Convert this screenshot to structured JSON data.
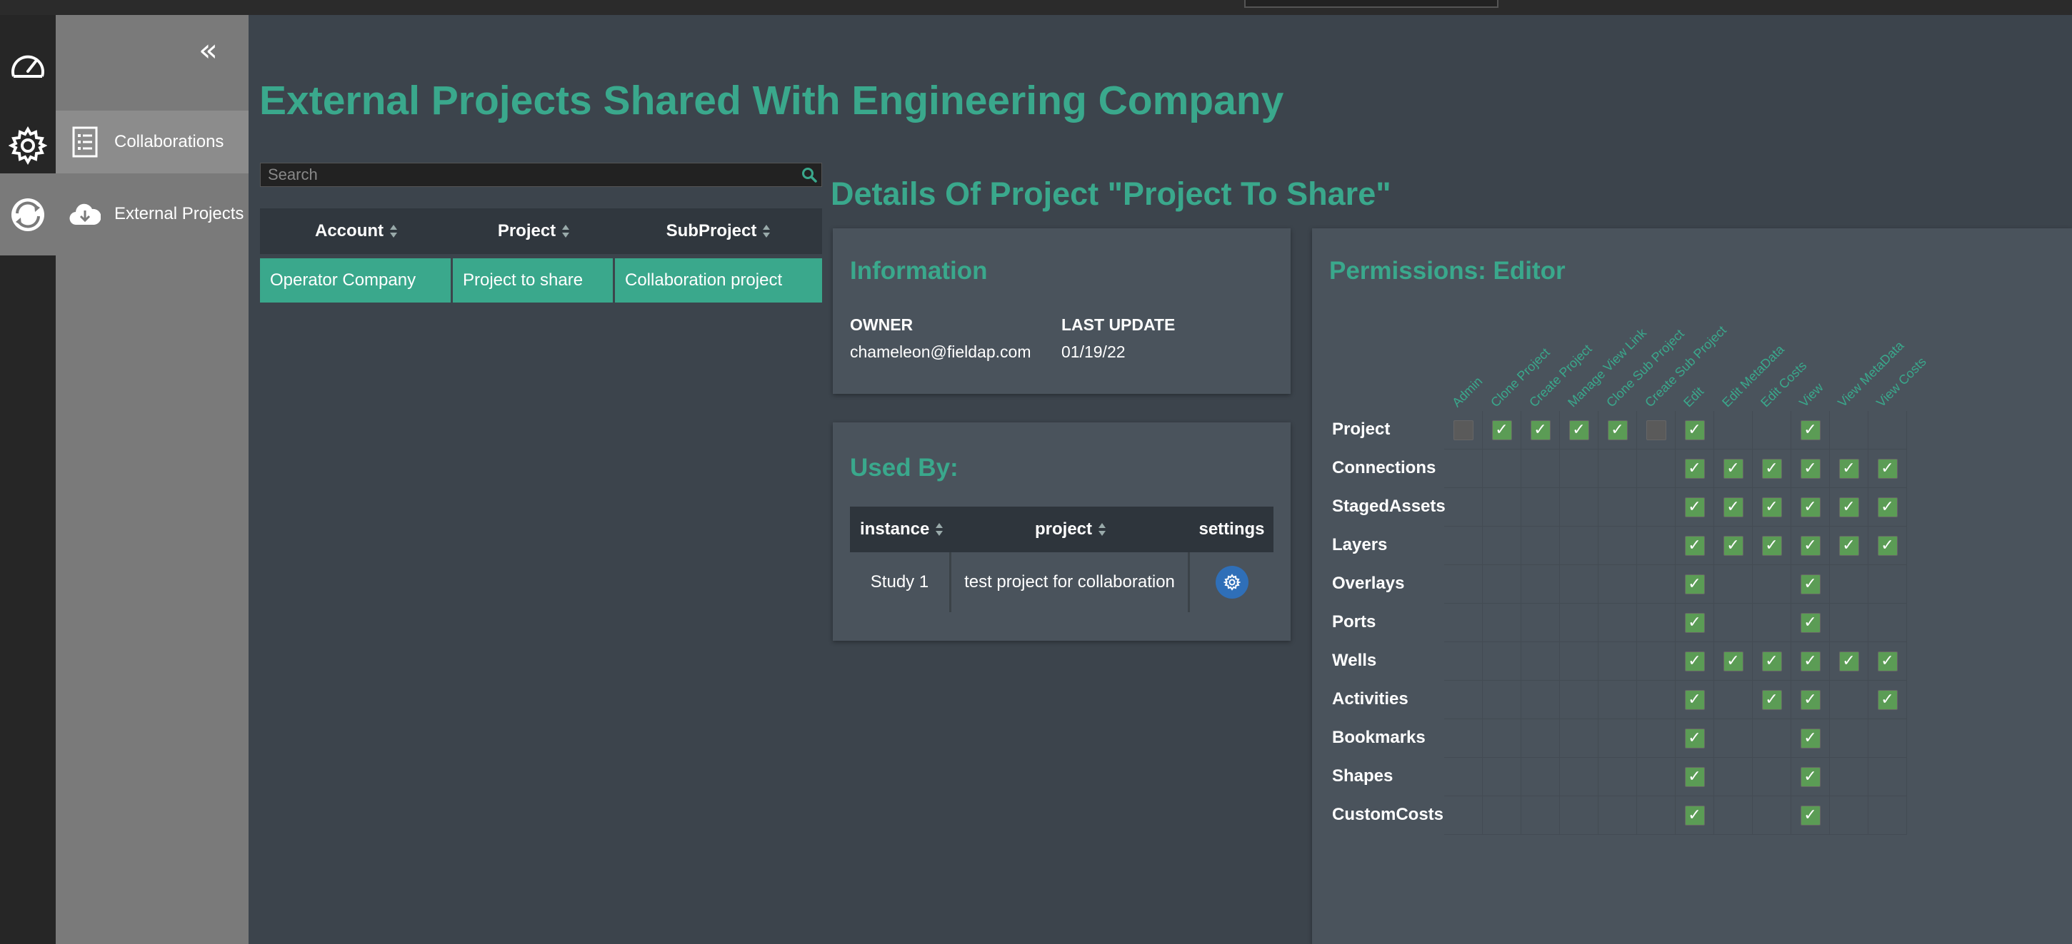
{
  "page_title": "External Projects Shared With Engineering Company",
  "sidebar": {
    "collapse_glyph": "«",
    "items": [
      {
        "label": "Collaborations",
        "icon": "list-document-icon"
      },
      {
        "label": "External Projects",
        "icon": "cloud-download-icon"
      }
    ]
  },
  "rail": {
    "icons": [
      "speedometer-icon",
      "gear-icon",
      "sync-globe-icon"
    ]
  },
  "search": {
    "placeholder": "Search"
  },
  "projects_table": {
    "headers": [
      "Account",
      "Project",
      "SubProject"
    ],
    "rows": [
      [
        "Operator Company",
        "Project to share",
        "Collaboration project"
      ]
    ]
  },
  "details": {
    "title": "Details Of Project \"Project To Share\"",
    "information": {
      "heading": "Information",
      "owner_label": "OWNER",
      "owner_value": "chameleon@fieldap.com",
      "last_update_label": "LAST UPDATE",
      "last_update_value": "01/19/22"
    },
    "used_by": {
      "heading": "Used By:",
      "headers": [
        "instance",
        "project",
        "settings"
      ],
      "rows": [
        {
          "instance": "Study 1",
          "project": "test project for collaboration"
        }
      ]
    },
    "permissions": {
      "heading": "Permissions: Editor",
      "columns": [
        "Admin",
        "Clone Project",
        "Create Project",
        "Manage View Link",
        "Clone Sub Project",
        "Create Sub Project",
        "Edit",
        "Edit MetaData",
        "Edit Costs",
        "View",
        "View MetaData",
        "View Costs"
      ],
      "rows": [
        {
          "name": "Project",
          "cells": [
            "off",
            "on",
            "on",
            "on",
            "on",
            "off",
            "on",
            "",
            "",
            "on",
            "",
            ""
          ]
        },
        {
          "name": "Connections",
          "cells": [
            "",
            "",
            "",
            "",
            "",
            "",
            "on",
            "on",
            "on",
            "on",
            "on",
            "on"
          ]
        },
        {
          "name": "StagedAssets",
          "cells": [
            "",
            "",
            "",
            "",
            "",
            "",
            "on",
            "on",
            "on",
            "on",
            "on",
            "on"
          ]
        },
        {
          "name": "Layers",
          "cells": [
            "",
            "",
            "",
            "",
            "",
            "",
            "on",
            "on",
            "on",
            "on",
            "on",
            "on"
          ]
        },
        {
          "name": "Overlays",
          "cells": [
            "",
            "",
            "",
            "",
            "",
            "",
            "on",
            "",
            "",
            "on",
            "",
            ""
          ]
        },
        {
          "name": "Ports",
          "cells": [
            "",
            "",
            "",
            "",
            "",
            "",
            "on",
            "",
            "",
            "on",
            "",
            ""
          ]
        },
        {
          "name": "Wells",
          "cells": [
            "",
            "",
            "",
            "",
            "",
            "",
            "on",
            "on",
            "on",
            "on",
            "on",
            "on"
          ]
        },
        {
          "name": "Activities",
          "cells": [
            "",
            "",
            "",
            "",
            "",
            "",
            "on",
            "",
            "on",
            "on",
            "",
            "on"
          ]
        },
        {
          "name": "Bookmarks",
          "cells": [
            "",
            "",
            "",
            "",
            "",
            "",
            "on",
            "",
            "",
            "on",
            "",
            ""
          ]
        },
        {
          "name": "Shapes",
          "cells": [
            "",
            "",
            "",
            "",
            "",
            "",
            "on",
            "",
            "",
            "on",
            "",
            ""
          ]
        },
        {
          "name": "CustomCosts",
          "cells": [
            "",
            "",
            "",
            "",
            "",
            "",
            "on",
            "",
            "",
            "on",
            "",
            ""
          ]
        }
      ]
    }
  },
  "colors": {
    "accent": "#3aa88c",
    "checkbox_on": "#5b9c55",
    "settings_button": "#2f6fb8"
  }
}
